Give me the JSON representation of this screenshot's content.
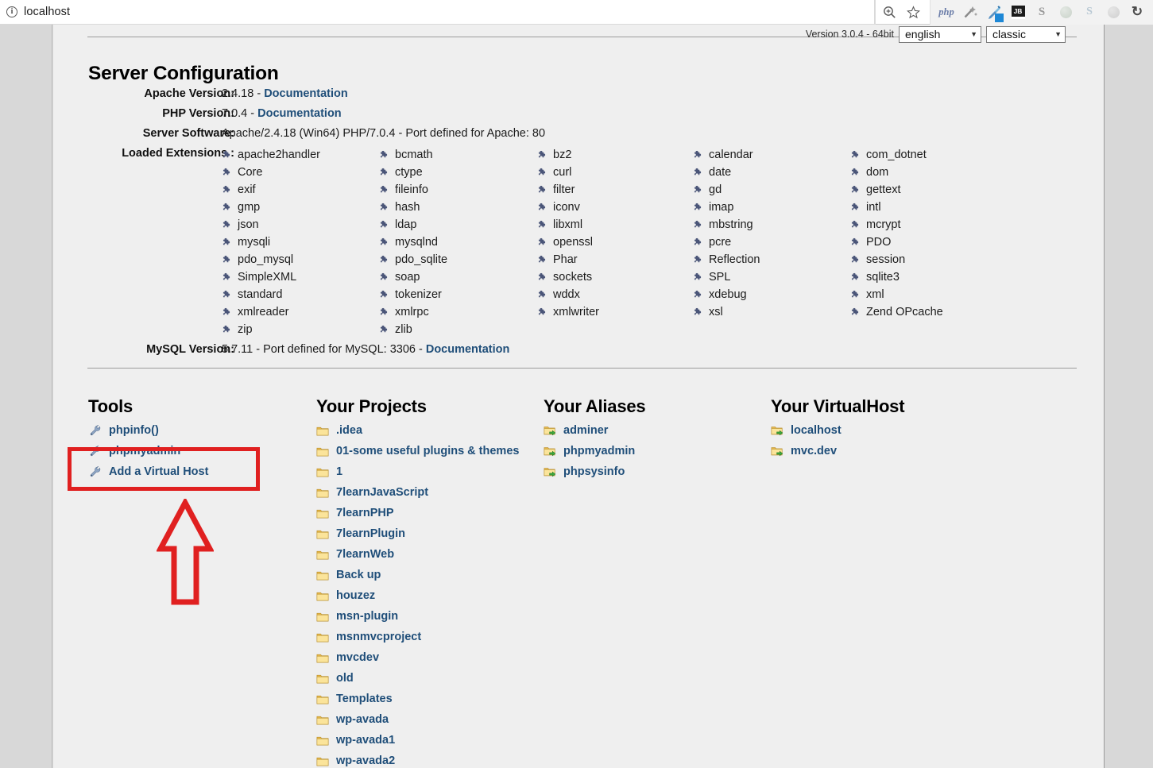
{
  "browser": {
    "url": "localhost",
    "info_icon": "info-circle-icon",
    "zoom_icon": "zoom-search-icon",
    "favorite_icon": "star-icon",
    "extensions": [
      {
        "name": "php-extension-icon",
        "label": "php"
      },
      {
        "name": "wand-extension-icon",
        "label": ""
      },
      {
        "name": "color-picker-extension-icon",
        "label": ""
      },
      {
        "name": "jetbrains-extension-icon",
        "label": "JB"
      },
      {
        "name": "s-extension-icon",
        "label": "S"
      },
      {
        "name": "green-globe-extension-icon",
        "label": ""
      },
      {
        "name": "skype-extension-icon",
        "label": "S"
      },
      {
        "name": "gray-ball-extension-icon",
        "label": ""
      },
      {
        "name": "refresh-extension-icon",
        "label": "↻"
      }
    ]
  },
  "topbar": {
    "version": "Version 3.0.4 - 64bit",
    "language": "english",
    "style": "classic"
  },
  "server": {
    "title": "Server Configuration",
    "rows": [
      {
        "label": "Apache Version:",
        "value": "2.4.18  - ",
        "link": "Documentation"
      },
      {
        "label": "PHP Version:",
        "value": "7.0.4  - ",
        "link": "Documentation"
      },
      {
        "label": "Server Software:",
        "value": "Apache/2.4.18 (Win64) PHP/7.0.4 - Port defined for Apache: 80",
        "link": ""
      },
      {
        "label": "Loaded Extensions :",
        "value": "",
        "link": ""
      }
    ],
    "mysql": {
      "label": "MySQL Version:",
      "value": "5.7.11 - Port defined for MySQL: 3306 - ",
      "link": "Documentation"
    },
    "extension_columns": [
      [
        "apache2handler",
        "Core",
        "exif",
        "gmp",
        "json",
        "mysqli",
        "pdo_mysql",
        "SimpleXML",
        "standard",
        "xmlreader",
        "zip"
      ],
      [
        "bcmath",
        "ctype",
        "fileinfo",
        "hash",
        "ldap",
        "mysqlnd",
        "pdo_sqlite",
        "soap",
        "tokenizer",
        "xmlrpc",
        "zlib"
      ],
      [
        "bz2",
        "curl",
        "filter",
        "iconv",
        "libxml",
        "openssl",
        "Phar",
        "sockets",
        "wddx",
        "xmlwriter"
      ],
      [
        "calendar",
        "date",
        "gd",
        "imap",
        "mbstring",
        "pcre",
        "Reflection",
        "SPL",
        "xdebug",
        "xsl"
      ],
      [
        "com_dotnet",
        "dom",
        "gettext",
        "intl",
        "mcrypt",
        "PDO",
        "session",
        "sqlite3",
        "xml",
        "Zend OPcache"
      ]
    ]
  },
  "tools": {
    "title": "Tools",
    "items": [
      "phpinfo()",
      "phpmyadmin",
      "Add a Virtual Host"
    ]
  },
  "projects": {
    "title": "Your Projects",
    "items": [
      ".idea",
      "01-some useful plugins & themes",
      "1",
      "7learnJavaScript",
      "7learnPHP",
      "7learnPlugin",
      "7learnWeb",
      "Back up",
      "houzez",
      "msn-plugin",
      "msnmvcproject",
      "mvcdev",
      "old",
      "Templates",
      "wp-avada",
      "wp-avada1",
      "wp-avada2"
    ]
  },
  "aliases": {
    "title": "Your Aliases",
    "items": [
      "adminer",
      "phpmyadmin",
      "phpsysinfo"
    ]
  },
  "virtualhost": {
    "title": "Your VirtualHost",
    "items": [
      "localhost",
      "mvc.dev"
    ]
  },
  "annotations": {
    "highlight_color": "#e02020",
    "highlight_target": "Add a Virtual Host",
    "arrow_color": "#e02020",
    "arrow_direction": "up"
  },
  "colors": {
    "link": "#1f4e79",
    "page_bg": "#efefef",
    "gutter_bg": "#d8d8d8",
    "puzzle": "#4a5578",
    "folder": "#f0c674"
  }
}
